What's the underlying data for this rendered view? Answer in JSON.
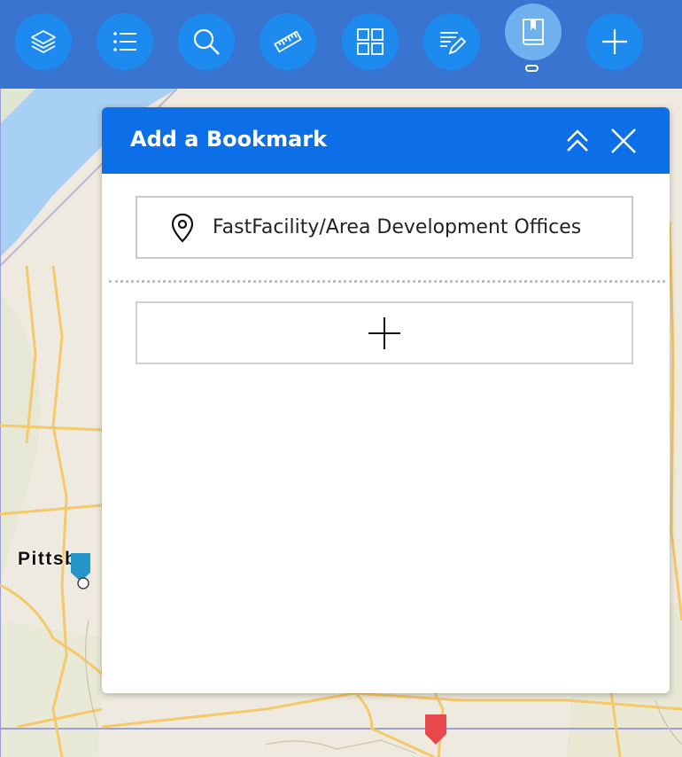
{
  "toolbar": {
    "tools": [
      {
        "name": "layers",
        "icon": "layers-icon"
      },
      {
        "name": "legend",
        "icon": "list-icon"
      },
      {
        "name": "search",
        "icon": "search-icon"
      },
      {
        "name": "measure",
        "icon": "ruler-icon"
      },
      {
        "name": "basemap-gallery",
        "icon": "grid-icon"
      },
      {
        "name": "edit",
        "icon": "edit-icon"
      },
      {
        "name": "bookmarks",
        "icon": "bookmark-icon",
        "active": true
      },
      {
        "name": "add",
        "icon": "plus-icon"
      }
    ]
  },
  "panel": {
    "title": "Add a Bookmark",
    "bookmarks": [
      {
        "label": "FastFacility/Area Development Offices",
        "icon": "map-pin-icon"
      }
    ],
    "add_icon": "plus-icon"
  },
  "map": {
    "city_label": "Pittsbu",
    "markers": [
      {
        "color": "#2596c8",
        "icon": "map-marker-icon"
      },
      {
        "color": "#e8474b",
        "icon": "map-marker-icon"
      }
    ]
  },
  "colors": {
    "toolbar_bg": "#3874d0",
    "tool_button": "#1d8af0",
    "tool_button_active": "#6fb0ee",
    "panel_header": "#0d6fe8"
  }
}
